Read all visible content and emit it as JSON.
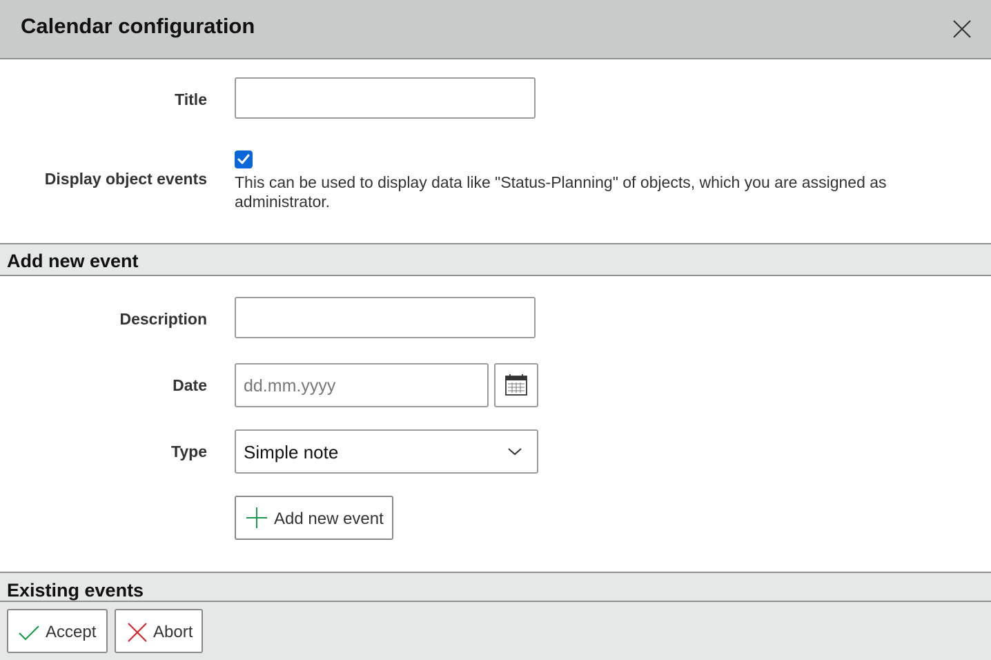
{
  "dialog": {
    "title": "Calendar configuration",
    "close_icon": "close-icon"
  },
  "general": {
    "title_label": "Title",
    "title_value": "",
    "display_events_label": "Display object events",
    "display_events_checked": true,
    "display_events_hint": "This can be used to display data like \"Status-Planning\" of objects, which you are assigned as administrator."
  },
  "add_event": {
    "section_title": "Add new event",
    "description_label": "Description",
    "description_value": "",
    "date_label": "Date",
    "date_placeholder": "dd.mm.yyyy",
    "date_icon": "calendar-icon",
    "type_label": "Type",
    "type_selected": "Simple note",
    "add_button_label": "Add new event",
    "add_icon": "plus-icon"
  },
  "existing_events": {
    "section_title": "Existing events"
  },
  "footer": {
    "accept_label": "Accept",
    "accept_icon": "check-icon",
    "abort_label": "Abort",
    "abort_icon": "x-icon"
  },
  "colors": {
    "accent_blue": "#0b67d9",
    "green": "#1a9a4a",
    "red": "#d9252a"
  }
}
